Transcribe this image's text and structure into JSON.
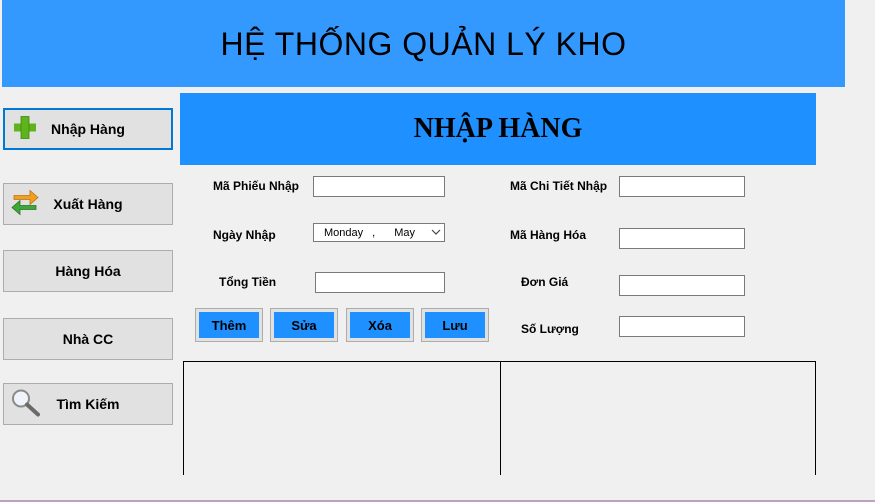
{
  "header": {
    "title": "HỆ THỐNG QUẢN LÝ KHO"
  },
  "sidebar": {
    "items": [
      {
        "label": "Nhập Hàng",
        "icon": "plus-icon"
      },
      {
        "label": "Xuất Hàng",
        "icon": "exchange-arrows-icon"
      },
      {
        "label": "Hàng Hóa"
      },
      {
        "label": "Nhà CC"
      },
      {
        "label": "Tìm Kiếm",
        "icon": "magnifier-icon"
      }
    ]
  },
  "panel": {
    "title": "NHẬP HÀNG"
  },
  "form": {
    "ma_phieu_nhap": {
      "label": "Mã Phiếu Nhập",
      "value": ""
    },
    "ngay_nhap": {
      "label": "Ngày Nhập",
      "day": "Monday",
      "separator": ",",
      "month": "May"
    },
    "tong_tien": {
      "label": "Tổng Tiền",
      "value": ""
    },
    "ma_chi_tiet_nhap": {
      "label": "Mã Chi Tiết Nhập",
      "value": ""
    },
    "ma_hang_hoa": {
      "label": "Mã Hàng Hóa",
      "value": ""
    },
    "don_gia": {
      "label": "Đơn Giá",
      "value": ""
    },
    "so_luong": {
      "label": "Số Lượng",
      "value": ""
    }
  },
  "actions": {
    "them": "Thêm",
    "sua": "Sửa",
    "xoa": "Xóa",
    "luu": "Lưu"
  },
  "colors": {
    "header_bg": "#3399ff",
    "panel_title_bg": "#1e90ff",
    "action_bg": "#1e90ff"
  }
}
